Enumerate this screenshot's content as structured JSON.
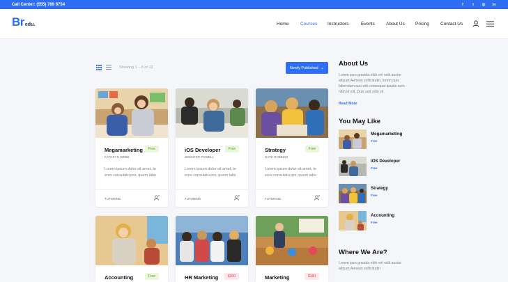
{
  "topbar": {
    "call_center": "Call Center: (555) 789 6754",
    "socials": [
      {
        "icon": "facebook-icon",
        "glyph": "f"
      },
      {
        "icon": "twitter-icon",
        "glyph": "t"
      },
      {
        "icon": "instagram-icon",
        "glyph": "◎"
      },
      {
        "icon": "linkedin-icon",
        "glyph": "in"
      }
    ]
  },
  "brand": {
    "logo_main": "Br",
    "logo_suffix": "edu."
  },
  "nav": {
    "items": [
      "Home",
      "Courses",
      "Instructors",
      "Events",
      "About Us",
      "Pricing",
      "Contact Us"
    ],
    "active": "Courses"
  },
  "toolbar": {
    "showing": "Showing 1 – 8 of 12",
    "sort_label": "Newly Published",
    "sort_caret": "⌄"
  },
  "courses": [
    {
      "title": "Megamarketing",
      "price": "Free",
      "author": "KATHRYN WEBB",
      "desc": "Lorem ipsum dolor sit amet, te eros consulatu pro, quem labo",
      "category": "TUTORING"
    },
    {
      "title": "iOS Developer",
      "price": "Free",
      "author": "JENNIFER POWELL",
      "desc": "Lorem ipsum dolor sit amet, te eros consulatu pro, quem labo",
      "category": "TUTORING"
    },
    {
      "title": "Strategy",
      "price": "Free",
      "author": "DAVE ROBBINS",
      "desc": "Lorem ipsum dolor sit amet, te eros consulatu pro, quem labo",
      "category": "TUTORING"
    },
    {
      "title": "Accounting",
      "price": "Free"
    },
    {
      "title": "HR Marketing",
      "price": "$300"
    },
    {
      "title": "Marketing",
      "price": "$180"
    }
  ],
  "sidebar": {
    "about_title": "About Us",
    "about_text": "Lorem ipsn gravida nibh vel velit auctor aliquet.Aenean sollicitudin, lorem quis bibendum auci elit consequat ipsutis sem nibh id elit. Duis sed odio sit",
    "read_more": "Read More",
    "like_title": "You May Like",
    "likes": [
      {
        "title": "Megamarketing",
        "price": "Free"
      },
      {
        "title": "iOS Developer",
        "price": "Free"
      },
      {
        "title": "Strategy",
        "price": "Free"
      },
      {
        "title": "Accounting",
        "price": "Free"
      }
    ],
    "where_title": "Where We Are?",
    "where_text": "Lorem ipsn gravida nibh vel velit auctor aliquet.Aenean sollicitudin"
  },
  "colors": {
    "accent": "#2f6ef2",
    "free_bg": "#eaf7dc",
    "paid_bg": "#fde8ea"
  }
}
